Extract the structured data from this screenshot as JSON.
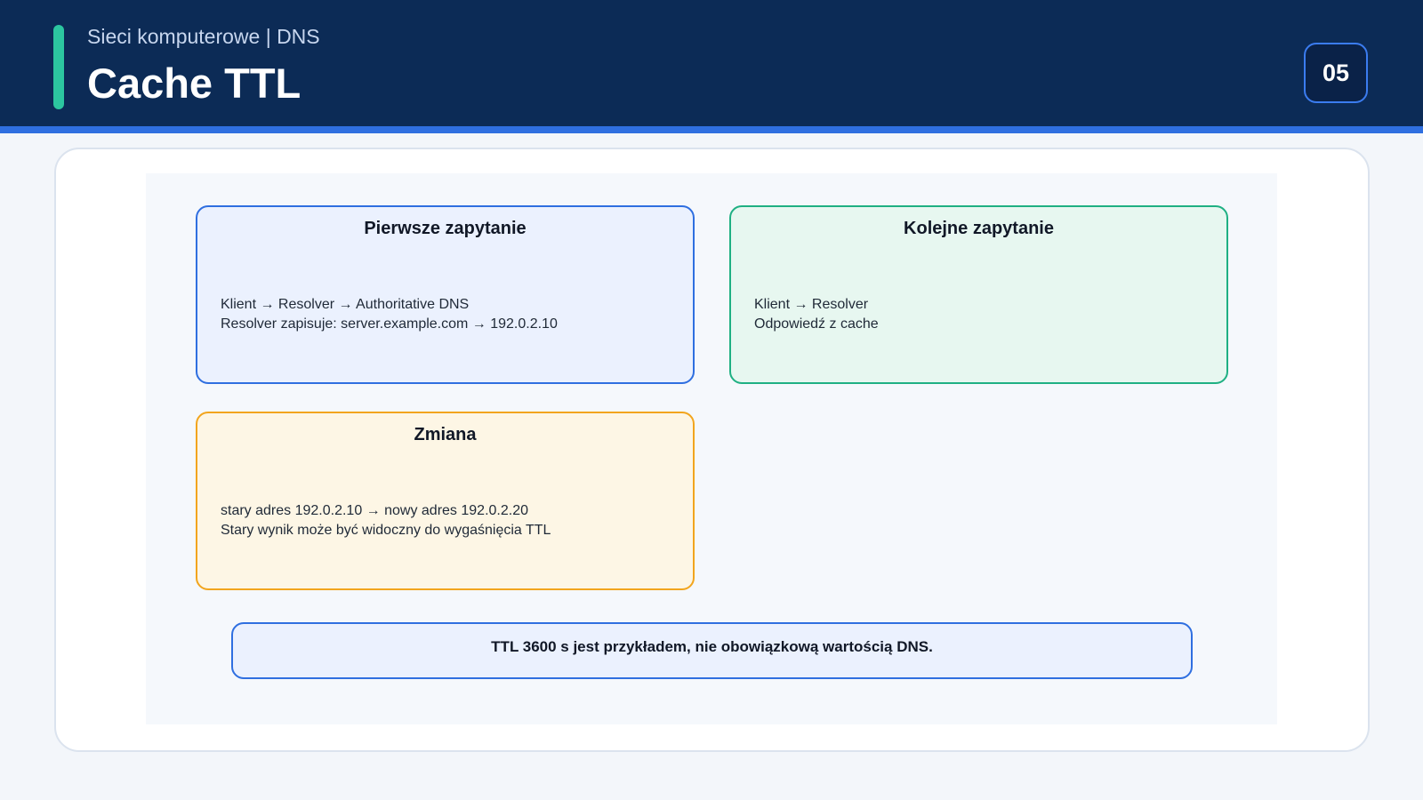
{
  "header": {
    "subtitle": "Sieci komputerowe | DNS",
    "title": "Cache TTL",
    "page_number": "05"
  },
  "colors": {
    "header_bg": "#0c2b56",
    "accent": "#2cc6a0",
    "rule": "#2f6fe0",
    "blue": "#2f6fe0",
    "green": "#1fb083",
    "orange": "#f2a51d"
  },
  "diagram": {
    "boxes": [
      {
        "title": "Pierwsze zapytanie",
        "lines": [
          "Klient → Resolver → Authoritative DNS",
          "Resolver zapisuje: server.example.com → 192.0.2.10"
        ]
      },
      {
        "title": "Kolejne zapytanie",
        "lines": [
          "Klient → Resolver",
          "Odpowiedź z cache"
        ]
      },
      {
        "title": "Zmiana",
        "lines": [
          "stary adres 192.0.2.10 → nowy adres 192.0.2.20",
          "Stary wynik może być widoczny do wygaśnięcia TTL"
        ]
      }
    ],
    "note": "TTL 3600 s jest przykładem, nie obowiązkową wartością DNS."
  }
}
